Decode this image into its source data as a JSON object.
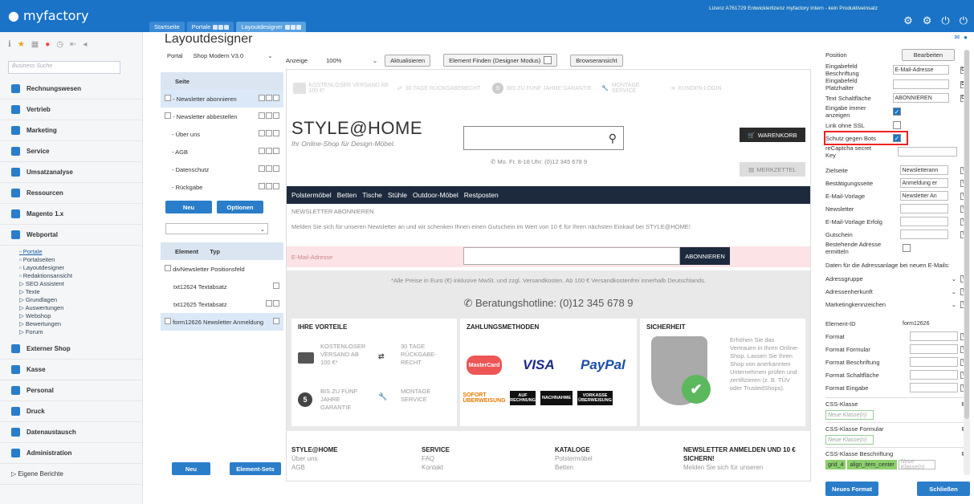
{
  "app": {
    "logo": "myfactory",
    "license": "Lizenz A761729 Entwicklerlizenz myfactory Intern - kein Produktiveinsatz"
  },
  "tabs": [
    {
      "label": "Startseite"
    },
    {
      "label": "Portale"
    },
    {
      "label": "Layoutdesigner"
    }
  ],
  "sidebar": {
    "search_placeholder": "Business Suche",
    "items": [
      {
        "label": "Rechnungswesen"
      },
      {
        "label": "Vertrieb"
      },
      {
        "label": "Marketing"
      },
      {
        "label": "Service"
      },
      {
        "label": "Umsatzanalyse"
      },
      {
        "label": "Ressourcen"
      },
      {
        "label": "Magento 1.x"
      },
      {
        "label": "Webportal"
      }
    ],
    "sub": [
      "Portale",
      "Portalseiten",
      "Layoutdesigner",
      "Redaktionsansicht",
      "▷ SEO Assistent",
      "▷ Texte",
      "▷ Grundlagen",
      "▷ Auswertungen",
      "▷ Webshop",
      "▷ Bewertungen",
      "▷ Forum"
    ],
    "items2": [
      {
        "label": "Externer Shop"
      },
      {
        "label": "Kasse"
      },
      {
        "label": "Personal"
      },
      {
        "label": "Druck"
      },
      {
        "label": "Datenaustausch"
      },
      {
        "label": "Administration"
      },
      {
        "label": "▷ Eigene Berichte"
      }
    ]
  },
  "designer": {
    "title": "Layoutdesigner",
    "portal_label": "Portal",
    "portal_value": "Shop Modern V3.0",
    "pages_head": "Seite",
    "pages": [
      "- Newsletter abonnieren",
      "- Newsletter abbestellen",
      "- Über uns",
      "- AGB",
      "- Datenschutz",
      "- Rückgabe"
    ],
    "btn_new": "Neu",
    "btn_options": "Optionen",
    "el_head": "Element",
    "type_head": "Typ",
    "elements": [
      {
        "name": "divNewsletter Positionsfeld",
        "type": ""
      },
      {
        "name": "txt12624",
        "type": "Textabsatz"
      },
      {
        "name": "txt12625",
        "type": "Textabsatz"
      },
      {
        "name": "form12626",
        "type": "Newsletter Anmeldung"
      }
    ],
    "btn_new2": "Neu",
    "btn_elset": "Element-Sets"
  },
  "toolbar": {
    "anzeige": "Anzeige",
    "zoom": "100%",
    "refresh": "Aktualisieren",
    "find": "Element Finden (Designer Modus)",
    "browser": "Browseransicht"
  },
  "preview": {
    "top": [
      "KOSTENLOSER VERSAND AB 100 €*",
      "30 TAGE RÜCKGABERECHT",
      "BIS ZU FÜNF JAHRE GARANTIE",
      "MONTAGE SERVICE",
      "KUNDEN-LOGIN"
    ],
    "logo": "STYLE@HOME",
    "tagline": "Ihr Online-Shop für Design-Möbel.",
    "hours": "Mo. Fr. 8-18 Uhr: (0)12 345 678 9",
    "cart": "WARENKORB",
    "wish": "MERKZETTEL",
    "menu": [
      "Polstermöbel",
      "Betten",
      "Tische",
      "Stühle",
      "Outdoor-Möbel",
      "Restposten"
    ],
    "nl_title": "NEWSLETTER ABONNIEREN",
    "nl_text": "Melden Sie sich für unseren Newsletter an und wir schenken Ihnen einen Gutschein im Wert von 10 € für Ihren nächsten Einkauf bei STYLE@HOME!",
    "nl_label": "E-Mail-Adresse",
    "nl_btn": "ABONNIEREN",
    "prices": "*Alle Preise in Euro (€) inklusive MwSt. und zzgl. Versandkosten. Ab 100 € Versandkostenfrei innerhalb Deutschlands.",
    "hotline": "Beratungshotline: (0)12 345 678 9",
    "col1": "IHRE VORTEILE",
    "col2": "ZAHLUNGSMETHODEN",
    "col3": "SICHERHEIT",
    "f1": "KOSTENLOSER VERSAND AB 100 €*",
    "f2": "30 TAGE RÜCKGABE-RECHT",
    "f3": "BIS ZU FÜNF JAHRE GARANTIE",
    "f4": "MONTAGE SERVICE",
    "sec_text": "Erhöhen Sie das Vertrauen in Ihren Online-Shop. Lassen Sie Ihren Shop von anerkannten Unternehmen prüfen und zertifizieren (z. B. TÜV oder TrustedShops).",
    "pay": {
      "mc": "MasterCard",
      "visa": "VISA",
      "paypal": "PayPal",
      "sofort": "SOFORT ÜBERWEISUNG",
      "rech": "AUF RECHNUNG",
      "nach": "NACHNAHME",
      "vork": "VORKASSE ÜBERWEISUNG"
    },
    "footer": [
      {
        "head": "STYLE@HOME",
        "l1": "Über uns",
        "l2": "AGB"
      },
      {
        "head": "SERVICE",
        "l1": "FAQ",
        "l2": "Kontakt"
      },
      {
        "head": "KATALOGE",
        "l1": "Polstermöbel",
        "l2": "Betten"
      },
      {
        "head": "NEWSLETTER ANMELDEN UND 10 € SICHERN!",
        "l1": "Melden Sie sich für unseren",
        "l2": ""
      }
    ]
  },
  "props": {
    "position": "Position",
    "edit": "Bearbeiten",
    "r1_label": "Eingabefeld Beschriftung",
    "r1_value": "E-Mail-Adresse",
    "r2_label": "Eingabefeld Platzhalter",
    "r3_label": "Text Schaltfläche",
    "r3_value": "ABONNIEREN",
    "r4_label": "Eingabe immer anzeigen",
    "r5_label": "Link ohne SSL",
    "r6_label": "Schutz gegen Bots",
    "r7_label": "reCaptcha secret Key",
    "r8_label": "Zielseite",
    "r8_value": "Newsletterann",
    "r9_label": "Bestätigungsseite",
    "r9_value": "Anmeldung er",
    "r10_label": "E-Mail-Vorlage",
    "r10_value": "Newsletter An",
    "r11_label": "Newsletter",
    "r12_label": "E-Mail-Vorlage Erfolg",
    "r13_label": "Gutschein",
    "r14_label": "Bestehende Adresse ermitteln",
    "sect": "Daten für die Adressanlage bei neuen E-Mails:",
    "r15_label": "Adressgruppe",
    "r16_label": "Adressenherkunft",
    "r17_label": "Marketingkennzeichen",
    "r18_label": "Element-ID",
    "r18_value": "form12626",
    "r19_label": "Format",
    "r20_label": "Format Formular",
    "r21_label": "Format Beschriftung",
    "r22_label": "Format Schaltfläche",
    "r23_label": "Format Eingabe",
    "css1": "CSS-Klasse",
    "css2": "CSS-Klasse Formular",
    "css3": "CSS-Klasse Beschriftung",
    "css_ph": "Neue Klasse(n)",
    "tag1": "grid_4",
    "tag2": "align_item_center",
    "btn_new_format": "Neues Format",
    "btn_close": "Schließen"
  }
}
